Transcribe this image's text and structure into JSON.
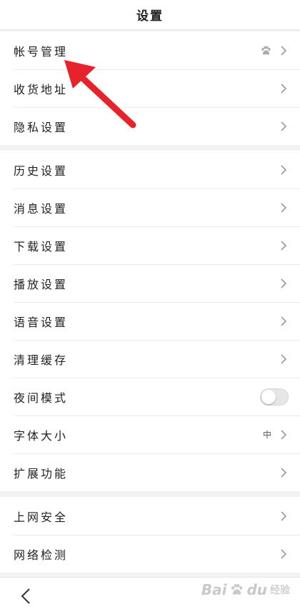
{
  "header": {
    "title": "设置"
  },
  "groups": [
    {
      "items": [
        {
          "label": "帐号管理",
          "accessory": "paw-icon"
        },
        {
          "label": "收货地址"
        },
        {
          "label": "隐私设置"
        }
      ]
    },
    {
      "items": [
        {
          "label": "历史设置"
        },
        {
          "label": "消息设置"
        },
        {
          "label": "下载设置"
        },
        {
          "label": "播放设置"
        },
        {
          "label": "语音设置"
        },
        {
          "label": "清理缓存"
        },
        {
          "label": "夜间模式",
          "toggle": false
        },
        {
          "label": "字体大小",
          "value": "中"
        },
        {
          "label": "扩展功能"
        }
      ]
    },
    {
      "items": [
        {
          "label": "上网安全"
        },
        {
          "label": "网络检测"
        }
      ]
    }
  ],
  "watermark": {
    "brand": "Bai",
    "brand2": "du",
    "sub": "经验"
  },
  "annotation": {
    "arrow_color": "#e8222b",
    "target": "帐号管理"
  },
  "colors": {
    "background": "#f2f2f2",
    "row": "#ffffff",
    "chevron": "#999999"
  }
}
